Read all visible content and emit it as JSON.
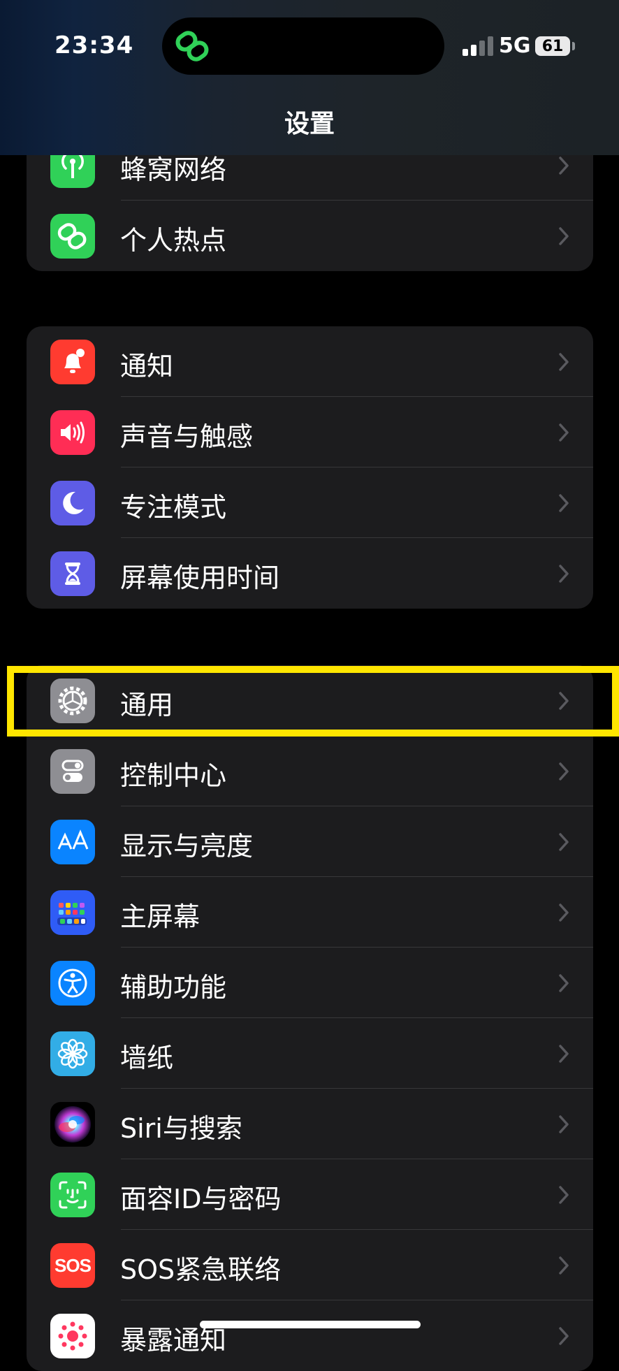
{
  "status_bar": {
    "time": "23:34",
    "network": "5G",
    "battery": "61"
  },
  "nav": {
    "title": "设置"
  },
  "groups": [
    {
      "items": [
        {
          "label": "蜂窝网络",
          "icon": "cellular-antenna-icon",
          "color": "#30d158"
        },
        {
          "label": "个人热点",
          "icon": "hotspot-link-icon",
          "color": "#30d158"
        }
      ]
    },
    {
      "items": [
        {
          "label": "通知",
          "icon": "bell-icon",
          "color": "#ff3b30"
        },
        {
          "label": "声音与触感",
          "icon": "speaker-icon",
          "color": "#ff2d55"
        },
        {
          "label": "专注模式",
          "icon": "moon-icon",
          "color": "#5e5ce6"
        },
        {
          "label": "屏幕使用时间",
          "icon": "hourglass-icon",
          "color": "#5e5ce6"
        }
      ]
    },
    {
      "items": [
        {
          "label": "通用",
          "icon": "gear-icon",
          "color": "#8e8e93",
          "highlighted": true
        },
        {
          "label": "控制中心",
          "icon": "toggles-icon",
          "color": "#8e8e93"
        },
        {
          "label": "显示与亮度",
          "icon": "aa-text-icon",
          "color": "#0a84ff"
        },
        {
          "label": "主屏幕",
          "icon": "app-grid-icon",
          "color": "#2f5cf6"
        },
        {
          "label": "辅助功能",
          "icon": "accessibility-icon",
          "color": "#0a84ff"
        },
        {
          "label": "墙纸",
          "icon": "flower-icon",
          "color": "#32ade6"
        },
        {
          "label": "Siri与搜索",
          "icon": "siri-icon",
          "color": "#000000"
        },
        {
          "label": "面容ID与密码",
          "icon": "face-id-icon",
          "color": "#30d158"
        },
        {
          "label": "SOS紧急联络",
          "icon": "sos-icon",
          "color": "#ff3b30",
          "icon_text": "SOS"
        },
        {
          "label": "暴露通知",
          "icon": "exposure-icon",
          "color": "#ffffff"
        }
      ]
    }
  ],
  "highlight_color": "#ffe600"
}
